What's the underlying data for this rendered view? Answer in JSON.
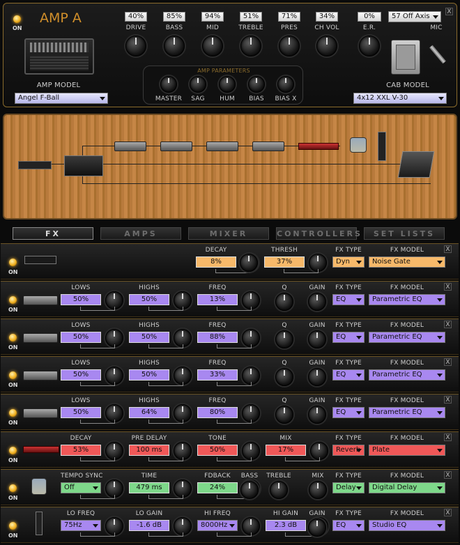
{
  "amp": {
    "on_label": "ON",
    "title": "AMP A",
    "params": [
      {
        "label": "DRIVE",
        "value": "40%"
      },
      {
        "label": "BASS",
        "value": "85%"
      },
      {
        "label": "MID",
        "value": "94%"
      },
      {
        "label": "TREBLE",
        "value": "51%"
      },
      {
        "label": "PRES",
        "value": "71%"
      },
      {
        "label": "CH VOL",
        "value": "34%"
      }
    ],
    "er": {
      "label": "E.R.",
      "value": "0%"
    },
    "mic": {
      "label": "MIC",
      "value": "57 Off Axis"
    },
    "amp_model_label": "AMP MODEL",
    "amp_model": "Angel F-Ball",
    "amp_parameters_title": "AMP PARAMETERS",
    "amp_parameters": [
      "MASTER",
      "SAG",
      "HUM",
      "BIAS",
      "BIAS X"
    ],
    "cab_model_label": "CAB MODEL",
    "cab_model": "4x12 XXL V-30",
    "close": "X"
  },
  "tabs": [
    "FX",
    "AMPS",
    "MIXER",
    "CONTROLLERS",
    "SET LISTS"
  ],
  "fx_rows": [
    {
      "on": "ON",
      "accent": "#f7b96a",
      "params": [
        {
          "label": "DECAY",
          "value": "8%"
        },
        {
          "label": "THRESH",
          "value": "37%"
        }
      ],
      "fx_type_label": "FX TYPE",
      "fx_type": "Dyn",
      "fx_model_label": "FX MODEL",
      "fx_model": "Noise Gate",
      "close": "X"
    },
    {
      "on": "ON",
      "accent": "#a888f0",
      "params": [
        {
          "label": "LOWS",
          "value": "50%"
        },
        {
          "label": "HIGHS",
          "value": "50%"
        },
        {
          "label": "FREQ",
          "value": "13%"
        }
      ],
      "q_label": "Q",
      "gain_label": "GAIN",
      "fx_type_label": "FX TYPE",
      "fx_type": "EQ",
      "fx_model_label": "FX MODEL",
      "fx_model": "Parametric EQ",
      "close": "X"
    },
    {
      "on": "ON",
      "accent": "#a888f0",
      "params": [
        {
          "label": "LOWS",
          "value": "50%"
        },
        {
          "label": "HIGHS",
          "value": "50%"
        },
        {
          "label": "FREQ",
          "value": "88%"
        }
      ],
      "q_label": "Q",
      "gain_label": "GAIN",
      "fx_type_label": "FX TYPE",
      "fx_type": "EQ",
      "fx_model_label": "FX MODEL",
      "fx_model": "Parametric EQ",
      "close": "X"
    },
    {
      "on": "ON",
      "accent": "#a888f0",
      "params": [
        {
          "label": "LOWS",
          "value": "50%"
        },
        {
          "label": "HIGHS",
          "value": "50%"
        },
        {
          "label": "FREQ",
          "value": "33%"
        }
      ],
      "q_label": "Q",
      "gain_label": "GAIN",
      "fx_type_label": "FX TYPE",
      "fx_type": "EQ",
      "fx_model_label": "FX MODEL",
      "fx_model": "Parametric EQ",
      "close": "X"
    },
    {
      "on": "ON",
      "accent": "#a888f0",
      "params": [
        {
          "label": "LOWS",
          "value": "50%"
        },
        {
          "label": "HIGHS",
          "value": "64%"
        },
        {
          "label": "FREQ",
          "value": "80%"
        }
      ],
      "q_label": "Q",
      "gain_label": "GAIN",
      "fx_type_label": "FX TYPE",
      "fx_type": "EQ",
      "fx_model_label": "FX MODEL",
      "fx_model": "Parametric EQ",
      "close": "X"
    },
    {
      "on": "ON",
      "accent": "#f05858",
      "params": [
        {
          "label": "DECAY",
          "value": "53%"
        },
        {
          "label": "PRE DELAY",
          "value": "100 ms"
        },
        {
          "label": "TONE",
          "value": "50%"
        },
        {
          "label": "MIX",
          "value": "17%"
        }
      ],
      "fx_type_label": "FX TYPE",
      "fx_type": "Reverb",
      "fx_model_label": "FX MODEL",
      "fx_model": "Plate",
      "close": "X"
    },
    {
      "on": "ON",
      "accent": "#7ed88a",
      "params": [
        {
          "label": "TEMPO SYNC",
          "value": "Off"
        },
        {
          "label": "TIME",
          "value": "479 ms"
        },
        {
          "label": "FDBACK",
          "value": "24%"
        }
      ],
      "extra_labels": [
        "BASS",
        "TREBLE",
        "MIX"
      ],
      "fx_type_label": "FX TYPE",
      "fx_type": "Delay",
      "fx_model_label": "FX MODEL",
      "fx_model": "Digital Delay",
      "close": "X"
    },
    {
      "on": "ON",
      "accent": "#a888f0",
      "params": [
        {
          "label": "LO FREQ",
          "value": "75Hz"
        },
        {
          "label": "LO GAIN",
          "value": "-1.6 dB"
        },
        {
          "label": "HI FREQ",
          "value": "8000Hz"
        },
        {
          "label": "HI GAIN",
          "value": "2.3 dB"
        }
      ],
      "gain_label": "GAIN",
      "fx_type_label": "FX TYPE",
      "fx_type": "EQ",
      "fx_model_label": "FX MODEL",
      "fx_model": "Studio EQ",
      "close": "X"
    }
  ]
}
